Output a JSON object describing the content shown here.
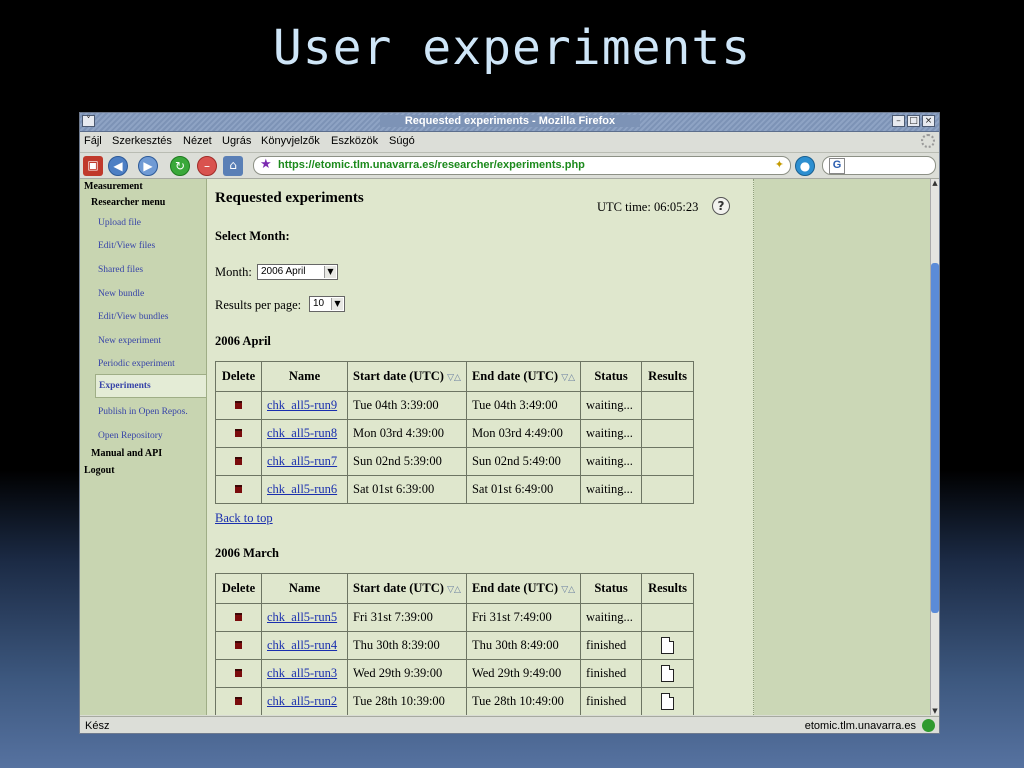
{
  "slide": {
    "title": "User experiments"
  },
  "window": {
    "title": "Requested experiments - Mozilla Firefox",
    "minimize": "–",
    "maximize": "□",
    "close": "×"
  },
  "menu": [
    {
      "label": "Fájl"
    },
    {
      "label": "Szerkesztés"
    },
    {
      "label": "Nézet"
    },
    {
      "label": "Ugrás"
    },
    {
      "label": "Könyvjelzők"
    },
    {
      "label": "Eszközök"
    },
    {
      "label": "Súgó"
    }
  ],
  "toolbar": {
    "url": "https://etomic.tlm.unavarra.es/researcher/experiments.php",
    "search_value": "G"
  },
  "sidebar": {
    "measurement": "Measurement",
    "researcher_menu": "Researcher menu",
    "items": [
      "Upload file",
      "Edit/View files",
      "Shared files",
      "New bundle",
      "Edit/View bundles",
      "New experiment",
      "Periodic experiment",
      "Experiments",
      "Publish in Open Repos.",
      "Open Repository"
    ],
    "manual": "Manual and API",
    "logout": "Logout"
  },
  "main": {
    "heading": "Requested experiments",
    "utc_label": "UTC time:",
    "utc_time": "06:05:23",
    "help": "?",
    "select_month": "Select Month:",
    "month_label": "Month:",
    "month_value": "2006 April",
    "rpp_label": "Results per page:",
    "rpp_value": "10",
    "columns": [
      "Delete",
      "Name",
      "Start date (UTC)",
      "End date (UTC)",
      "Status",
      "Results"
    ],
    "sections": [
      {
        "title": "2006 April",
        "rows": [
          {
            "name": "chk_all5-run9",
            "start": "Tue 04th 3:39:00",
            "end": "Tue 04th 3:49:00",
            "status": "waiting...",
            "result": false
          },
          {
            "name": "chk_all5-run8",
            "start": "Mon 03rd 4:39:00",
            "end": "Mon 03rd 4:49:00",
            "status": "waiting...",
            "result": false
          },
          {
            "name": "chk_all5-run7",
            "start": "Sun 02nd 5:39:00",
            "end": "Sun 02nd 5:49:00",
            "status": "waiting...",
            "result": false
          },
          {
            "name": "chk_all5-run6",
            "start": "Sat 01st 6:39:00",
            "end": "Sat 01st 6:49:00",
            "status": "waiting...",
            "result": false
          }
        ]
      },
      {
        "title": "2006 March",
        "rows": [
          {
            "name": "chk_all5-run5",
            "start": "Fri 31st 7:39:00",
            "end": "Fri 31st 7:49:00",
            "status": "waiting...",
            "result": false
          },
          {
            "name": "chk_all5-run4",
            "start": "Thu 30th 8:39:00",
            "end": "Thu 30th 8:49:00",
            "status": "finished",
            "result": true
          },
          {
            "name": "chk_all5-run3",
            "start": "Wed 29th 9:39:00",
            "end": "Wed 29th 9:49:00",
            "status": "finished",
            "result": true
          },
          {
            "name": "chk_all5-run2",
            "start": "Tue 28th 10:39:00",
            "end": "Tue 28th 10:49:00",
            "status": "finished",
            "result": true
          }
        ]
      }
    ],
    "back_to_top": "Back to top"
  },
  "statusbar": {
    "left": "Kész",
    "right": "etomic.tlm.unavarra.es"
  }
}
